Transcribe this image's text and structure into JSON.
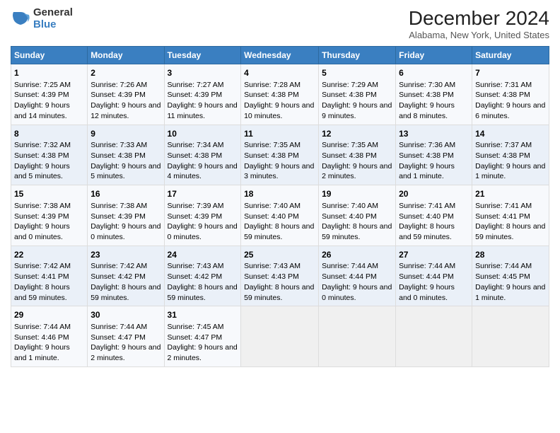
{
  "logo": {
    "general": "General",
    "blue": "Blue"
  },
  "header": {
    "title": "December 2024",
    "subtitle": "Alabama, New York, United States"
  },
  "calendar": {
    "days": [
      "Sunday",
      "Monday",
      "Tuesday",
      "Wednesday",
      "Thursday",
      "Friday",
      "Saturday"
    ],
    "weeks": [
      [
        {
          "day": 1,
          "sunrise": "7:25 AM",
          "sunset": "4:39 PM",
          "daylight": "9 hours and 14 minutes."
        },
        {
          "day": 2,
          "sunrise": "7:26 AM",
          "sunset": "4:39 PM",
          "daylight": "9 hours and 12 minutes."
        },
        {
          "day": 3,
          "sunrise": "7:27 AM",
          "sunset": "4:39 PM",
          "daylight": "9 hours and 11 minutes."
        },
        {
          "day": 4,
          "sunrise": "7:28 AM",
          "sunset": "4:38 PM",
          "daylight": "9 hours and 10 minutes."
        },
        {
          "day": 5,
          "sunrise": "7:29 AM",
          "sunset": "4:38 PM",
          "daylight": "9 hours and 9 minutes."
        },
        {
          "day": 6,
          "sunrise": "7:30 AM",
          "sunset": "4:38 PM",
          "daylight": "9 hours and 8 minutes."
        },
        {
          "day": 7,
          "sunrise": "7:31 AM",
          "sunset": "4:38 PM",
          "daylight": "9 hours and 6 minutes."
        }
      ],
      [
        {
          "day": 8,
          "sunrise": "7:32 AM",
          "sunset": "4:38 PM",
          "daylight": "9 hours and 5 minutes."
        },
        {
          "day": 9,
          "sunrise": "7:33 AM",
          "sunset": "4:38 PM",
          "daylight": "9 hours and 5 minutes."
        },
        {
          "day": 10,
          "sunrise": "7:34 AM",
          "sunset": "4:38 PM",
          "daylight": "9 hours and 4 minutes."
        },
        {
          "day": 11,
          "sunrise": "7:35 AM",
          "sunset": "4:38 PM",
          "daylight": "9 hours and 3 minutes."
        },
        {
          "day": 12,
          "sunrise": "7:35 AM",
          "sunset": "4:38 PM",
          "daylight": "9 hours and 2 minutes."
        },
        {
          "day": 13,
          "sunrise": "7:36 AM",
          "sunset": "4:38 PM",
          "daylight": "9 hours and 1 minute."
        },
        {
          "day": 14,
          "sunrise": "7:37 AM",
          "sunset": "4:38 PM",
          "daylight": "9 hours and 1 minute."
        }
      ],
      [
        {
          "day": 15,
          "sunrise": "7:38 AM",
          "sunset": "4:39 PM",
          "daylight": "9 hours and 0 minutes."
        },
        {
          "day": 16,
          "sunrise": "7:38 AM",
          "sunset": "4:39 PM",
          "daylight": "9 hours and 0 minutes."
        },
        {
          "day": 17,
          "sunrise": "7:39 AM",
          "sunset": "4:39 PM",
          "daylight": "9 hours and 0 minutes."
        },
        {
          "day": 18,
          "sunrise": "7:40 AM",
          "sunset": "4:40 PM",
          "daylight": "8 hours and 59 minutes."
        },
        {
          "day": 19,
          "sunrise": "7:40 AM",
          "sunset": "4:40 PM",
          "daylight": "8 hours and 59 minutes."
        },
        {
          "day": 20,
          "sunrise": "7:41 AM",
          "sunset": "4:40 PM",
          "daylight": "8 hours and 59 minutes."
        },
        {
          "day": 21,
          "sunrise": "7:41 AM",
          "sunset": "4:41 PM",
          "daylight": "8 hours and 59 minutes."
        }
      ],
      [
        {
          "day": 22,
          "sunrise": "7:42 AM",
          "sunset": "4:41 PM",
          "daylight": "8 hours and 59 minutes."
        },
        {
          "day": 23,
          "sunrise": "7:42 AM",
          "sunset": "4:42 PM",
          "daylight": "8 hours and 59 minutes."
        },
        {
          "day": 24,
          "sunrise": "7:43 AM",
          "sunset": "4:42 PM",
          "daylight": "8 hours and 59 minutes."
        },
        {
          "day": 25,
          "sunrise": "7:43 AM",
          "sunset": "4:43 PM",
          "daylight": "8 hours and 59 minutes."
        },
        {
          "day": 26,
          "sunrise": "7:44 AM",
          "sunset": "4:44 PM",
          "daylight": "9 hours and 0 minutes."
        },
        {
          "day": 27,
          "sunrise": "7:44 AM",
          "sunset": "4:44 PM",
          "daylight": "9 hours and 0 minutes."
        },
        {
          "day": 28,
          "sunrise": "7:44 AM",
          "sunset": "4:45 PM",
          "daylight": "9 hours and 1 minute."
        }
      ],
      [
        {
          "day": 29,
          "sunrise": "7:44 AM",
          "sunset": "4:46 PM",
          "daylight": "9 hours and 1 minute."
        },
        {
          "day": 30,
          "sunrise": "7:44 AM",
          "sunset": "4:47 PM",
          "daylight": "9 hours and 2 minutes."
        },
        {
          "day": 31,
          "sunrise": "7:45 AM",
          "sunset": "4:47 PM",
          "daylight": "9 hours and 2 minutes."
        },
        null,
        null,
        null,
        null
      ]
    ]
  },
  "labels": {
    "sunrise": "Sunrise:",
    "sunset": "Sunset:",
    "daylight": "Daylight:"
  }
}
